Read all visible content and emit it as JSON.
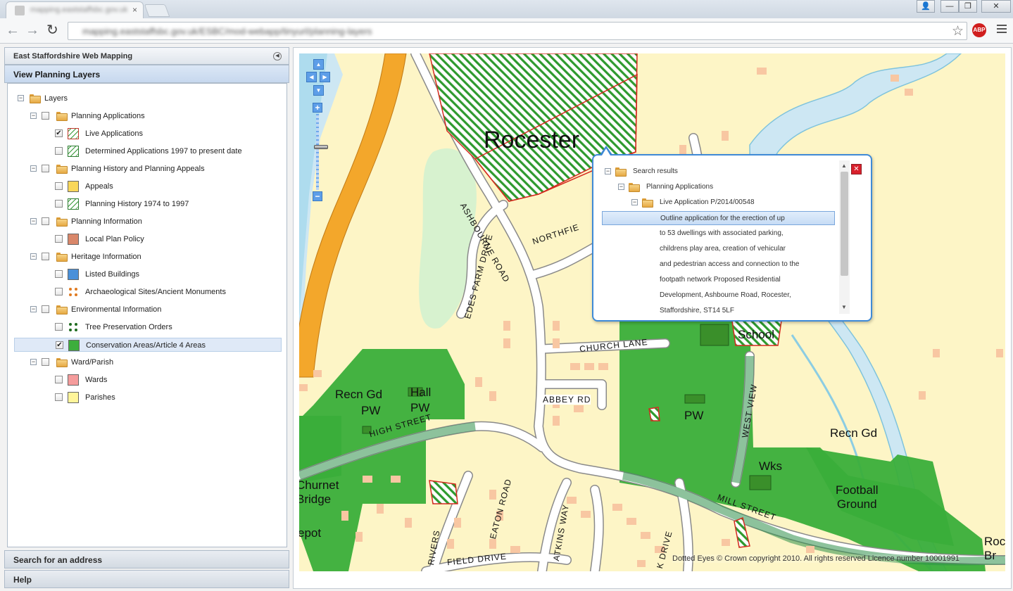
{
  "browser": {
    "tab_title": "mapping.eaststaffsbc.gov.uk",
    "tab_close": "×",
    "url": "mapping.eaststaffsbc.gov.uk/ESBC/mod-webapp/tinyurl/planning-layers",
    "back_glyph": "←",
    "forward_glyph": "→",
    "reload_glyph": "↻",
    "star_glyph": "☆",
    "abp_label": "ABP",
    "window_buttons": {
      "user": "👤",
      "minimize": "—",
      "restore": "❐",
      "close": "✕"
    }
  },
  "app": {
    "title": "East Staffordshire Web Mapping",
    "collapse_glyph": "◀",
    "accordion": {
      "layers_title": "View Planning Layers",
      "search_title": "Search for an address",
      "help_title": "Help"
    }
  },
  "tree": {
    "root": "Layers",
    "toggle_glyph": "−",
    "check_glyph": "✔",
    "groups": [
      {
        "label": "Planning Applications",
        "items": [
          {
            "label": "Live Applications",
            "checked": true
          },
          {
            "label": "Determined Applications 1997 to present date",
            "checked": false
          }
        ]
      },
      {
        "label": "Planning History and Planning Appeals",
        "items": [
          {
            "label": "Appeals",
            "checked": false
          },
          {
            "label": "Planning History 1974 to 1997",
            "checked": false
          }
        ]
      },
      {
        "label": "Planning Information",
        "items": [
          {
            "label": "Local Plan Policy",
            "checked": false
          }
        ]
      },
      {
        "label": "Heritage Information",
        "items": [
          {
            "label": "Listed Buildings",
            "checked": false
          },
          {
            "label": "Archaeological Sites/Ancient Monuments",
            "checked": false
          }
        ]
      },
      {
        "label": "Environmental Information",
        "items": [
          {
            "label": "Tree Preservation Orders",
            "checked": false
          },
          {
            "label": "Conservation Areas/Article 4 Areas",
            "checked": true
          }
        ]
      },
      {
        "label": "Ward/Parish",
        "items": [
          {
            "label": "Wards",
            "checked": false
          },
          {
            "label": "Parishes",
            "checked": false
          }
        ]
      }
    ]
  },
  "swatch_colors": {
    "appeals": "#f9d75a",
    "local_plan_policy": "#d9876a",
    "listed_buildings": "#4a90d9",
    "conservation": "#3dae3d",
    "wards": "#f59c9c",
    "parishes": "#fff59a"
  },
  "map": {
    "controls": {
      "pan_up": "▲",
      "pan_down": "▼",
      "pan_left": "◀",
      "pan_right": "▶",
      "zoom_in": "+",
      "zoom_out": "−"
    },
    "labels": {
      "rocester": "Rocester",
      "ashbourne_road": "ASHBOURNE ROAD",
      "northfield": "NORTHFIE",
      "edes_farm_drive": "EDES FARM DRIVE",
      "church_lane": "CHURCH LANE",
      "abbey_rd": "ABBEY RD",
      "high_street": "HIGH STREET",
      "mill_street": "MILL STREET",
      "west_view": "WEST VIEW",
      "eaton_road": "EATON ROAD",
      "atkins_way": "ATKINS WAY",
      "riversfield_drive_a": "RIVERS",
      "riversfield_drive_b": "FIELD DRIVE",
      "k_drive": "K DRIVE",
      "recn_gd_1": "Recn Gd",
      "pw_1": "PW",
      "hall": "Hall",
      "pw_2": "PW",
      "pw_3": "PW",
      "recn_gd_2": "Recn Gd",
      "wks": "Wks",
      "football_ground": "Football\nGround",
      "churnet_bridge": "Churnet\nBridge",
      "depot": "epot",
      "school": "School",
      "roc_br": "Roc\nBr"
    },
    "copyright": "Dotted Eyes © Crown copyright 2010. All rights reserved Licence number 10001991"
  },
  "popup": {
    "close_glyph": "✕",
    "scroll_up": "▲",
    "scroll_down": "▼",
    "root": "Search results",
    "group": "Planning Applications",
    "application": "Live Application P/2014/00548",
    "description_lines": [
      "Outline application for the erection of up",
      "to 53 dwellings with associated parking,",
      "childrens play area, creation of vehicular",
      "and pedestrian access and connection to the",
      "footpath network Proposed Residential",
      "Development, Ashbourne Road, Rocester,",
      "Staffordshire, ST14 5LF"
    ]
  }
}
